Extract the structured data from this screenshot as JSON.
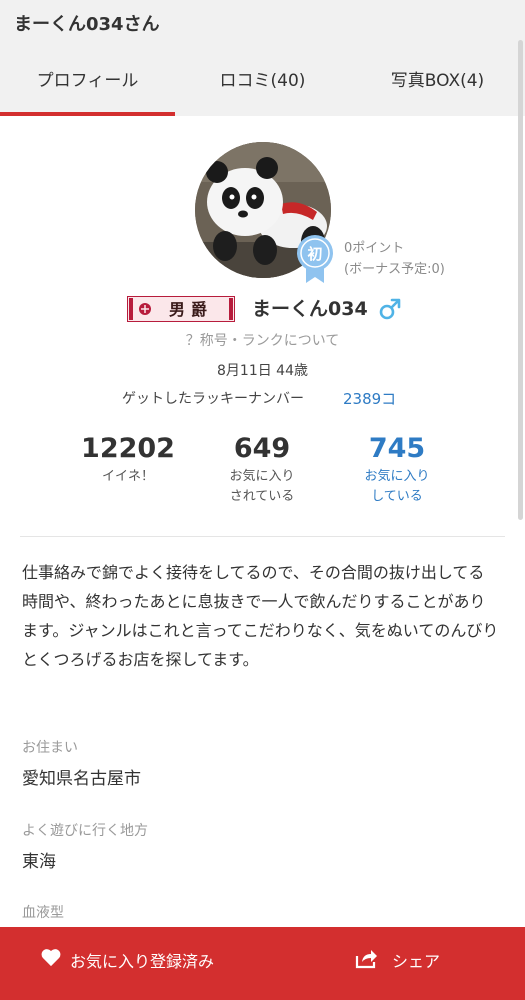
{
  "header": {
    "title": "まーくん034さん"
  },
  "tabs": [
    {
      "label": "プロフィール",
      "active": true
    },
    {
      "label": "ロコミ(40)"
    },
    {
      "label": "写真BOX(4)"
    }
  ],
  "profile": {
    "username": "まーくん034",
    "gender_icon": "male-icon",
    "rank_title": "男爵",
    "badge_text": "初",
    "points": "0ポイント",
    "bonus": "(ボーナス予定:0)",
    "rank_help": "？称号・ランクについて",
    "birthday": "8月11日 44歳",
    "lucky_label": "ゲットしたラッキーナンバー",
    "lucky_value": "2389コ"
  },
  "stats": [
    {
      "value": "12202",
      "label_line1": "イイネ！",
      "label_line2": ""
    },
    {
      "value": "649",
      "label_line1": "お気に入り",
      "label_line2": "されている"
    },
    {
      "value": "745",
      "label_line1": "お気に入り",
      "label_line2": "している"
    }
  ],
  "bio": "仕事絡みで錦でよく接待をしてるので、その合間の抜け出してる時間や、終わったあとに息抜きで一人で飲んだりすることがあります。ジャンルはこれと言ってこだわりなく、気をぬいてのんびりとくつろげるお店を探してます。",
  "fields": [
    {
      "label": "お住まい",
      "value": "愛知県名古屋市"
    },
    {
      "label": "よく遊びに行く地方",
      "value": "東海"
    },
    {
      "label": "血液型",
      "value": ""
    }
  ],
  "actions": {
    "favorite_label": "お気に入り登録済み",
    "share_label": "シェア"
  },
  "colors": {
    "accent": "#d32f2f",
    "link": "#2e7bc4",
    "badge": "#8fc3ef"
  }
}
